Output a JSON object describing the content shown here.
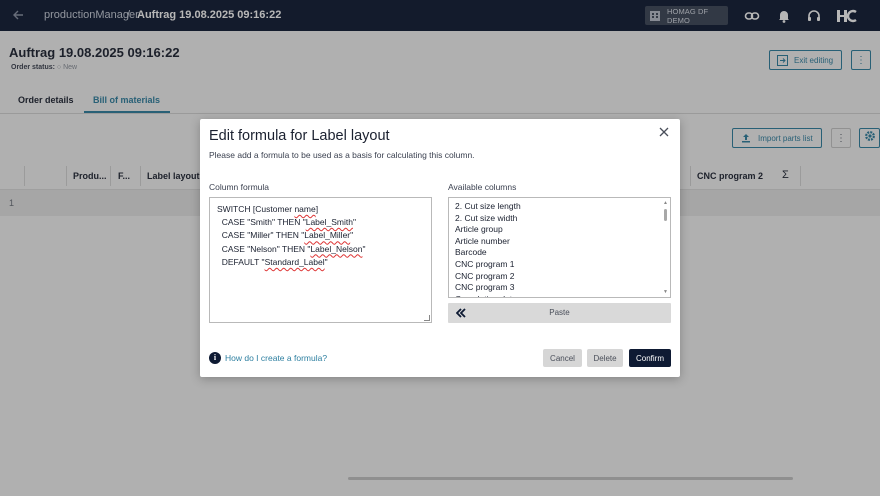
{
  "topbar": {
    "app_name": "productionManager",
    "separator": "/",
    "order_title": "Auftrag 19.08.2025 09:16:22",
    "tenant": "HOMAG DF DEMO",
    "icons": [
      "back-arrow-icon",
      "building-icon",
      "link-icon",
      "bell-icon",
      "support-icon",
      "homag-logo"
    ]
  },
  "header": {
    "title": "Auftrag 19.08.2025 09:16:22",
    "status_label": "Order status:",
    "status_value": "○ New",
    "exit_label": "Exit editing",
    "more": "⋮"
  },
  "tabs": [
    {
      "label": "Order details",
      "active": false
    },
    {
      "label": "Bill of materials",
      "active": true
    }
  ],
  "toolbar": {
    "import_label": "Import parts list",
    "kebab": "⋮"
  },
  "grid": {
    "columns": [
      "Produ...",
      "F...",
      "Label layout",
      "CNC program 2"
    ],
    "sigma": "Σ",
    "rows": [
      "1"
    ]
  },
  "dialog": {
    "title": "Edit formula for Label layout",
    "subtitle": "Please add a formula to be used as a basis for calculating this column.",
    "formula_label": "Column formula",
    "formula_lines": [
      {
        "pre": "SWITCH [Customer ",
        "sq": "name",
        "post": "]"
      },
      {
        "pre": "  CASE \"Smith\" THEN \"",
        "sq": "Label_Smith",
        "post": "\""
      },
      {
        "pre": "  CASE \"Miller\" THEN \"",
        "sq": "Label_Miller",
        "post": "\""
      },
      {
        "pre": "  CASE \"Nelson\" THEN \"",
        "sq": "Label_Nelson",
        "post": "\""
      },
      {
        "pre": "  DEFAULT \"",
        "sq": "Standard_Label",
        "post": "\""
      }
    ],
    "available_label": "Available columns",
    "available_columns": [
      "2. Cut size length",
      "2. Cut size width",
      "Article group",
      "Article number",
      "Barcode",
      "CNC program 1",
      "CNC program 2",
      "CNC program 3",
      "Completion date"
    ],
    "paste_label": "Paste",
    "help_label": "How do I create a formula?",
    "cancel_label": "Cancel",
    "delete_label": "Delete",
    "confirm_label": "Confirm"
  },
  "colors": {
    "topbar": "#0e1a33",
    "accent": "#2d7fa0",
    "confirm": "#0e1a33"
  }
}
